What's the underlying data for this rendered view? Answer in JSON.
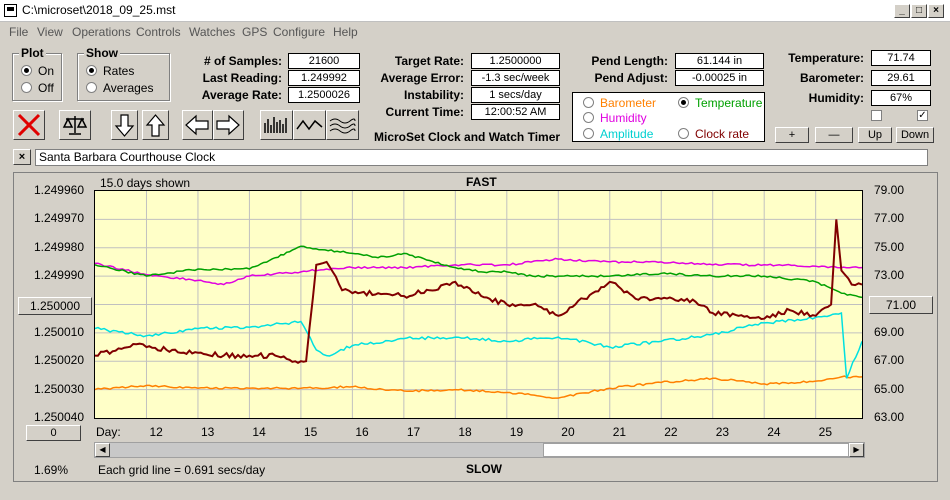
{
  "window": {
    "title": "C:\\microset\\2018_09_25.mst",
    "min": "_",
    "max": "□",
    "close": "×"
  },
  "menu": [
    "File",
    "View",
    "Operations",
    "Controls",
    "Watches",
    "GPS",
    "Configure",
    "Help"
  ],
  "plot_group": {
    "title": "Plot",
    "on": "On",
    "off": "Off"
  },
  "show_group": {
    "title": "Show",
    "rates": "Rates",
    "averages": "Averages"
  },
  "stats": {
    "samples_label": "# of Samples:",
    "samples": "21600",
    "last_label": "Last Reading:",
    "last": "1.249992",
    "avg_label": "Average Rate:",
    "avg": "1.2500026"
  },
  "rates": {
    "target_label": "Target Rate:",
    "target": "1.2500000",
    "avgerr_label": "Average Error:",
    "avgerr": "-1.3 sec/week",
    "instab_label": "Instability:",
    "instab": "1 secs/day",
    "time_label": "Current Time:",
    "time": "12:00:52 AM"
  },
  "pend": {
    "length_label": "Pend Length:",
    "length": "61.144 in",
    "adjust_label": "Pend Adjust:",
    "adjust": "-0.00025 in"
  },
  "sensor_options": {
    "barometer": "Barometer",
    "temperature": "Temperature",
    "humidity": "Humidity",
    "amplitude": "Amplitude",
    "clock_rate": "Clock rate"
  },
  "colors": {
    "barometer": "#ff8000",
    "temperature": "#00a000",
    "humidity": "#e000e0",
    "amplitude": "#00e0e0",
    "rate": "#800000"
  },
  "env": {
    "temp_label": "Temperature:",
    "temp": "71.74",
    "baro_label": "Barometer:",
    "baro": "29.61",
    "hum_label": "Humidity:",
    "hum": "67%"
  },
  "adjust_buttons": {
    "plus": "+",
    "minus": "—",
    "up": "Up",
    "down": "Down"
  },
  "app_title": "MicroSet Clock and Watch Timer",
  "clock_name": "Santa Barbara Courthouse Clock",
  "chart_data": {
    "type": "line",
    "title": "FAST",
    "bottom_label": "SLOW",
    "days_shown": "15.0 days shown",
    "grid_note": "Each grid line = 0.691 secs/day",
    "percent": "1.69%",
    "left_center_button": "1.250000",
    "right_center_button": "71.00",
    "zero_button": "0",
    "x_label": "Day:",
    "x_ticks": [
      "12",
      "13",
      "14",
      "15",
      "16",
      "17",
      "18",
      "19",
      "20",
      "21",
      "22",
      "23",
      "24",
      "25"
    ],
    "y_left_ticks": [
      "1.249960",
      "1.249970",
      "1.249980",
      "1.249990",
      "1.250000",
      "1.250010",
      "1.250020",
      "1.250030",
      "1.250040"
    ],
    "y_right_ticks": [
      "79.00",
      "77.00",
      "75.00",
      "73.00",
      "71.00",
      "69.00",
      "67.00",
      "65.00",
      "63.00"
    ],
    "x_range": [
      11,
      25.9
    ],
    "y_left_range": [
      1.24996,
      1.25004
    ],
    "y_right_range": [
      63,
      79
    ],
    "series": [
      {
        "key": "rate",
        "axis": "left",
        "x": [
          11,
          11.8,
          12,
          12.5,
          13,
          13.5,
          14,
          14.5,
          15,
          15.1,
          15.3,
          15.5,
          15.8,
          16,
          16.5,
          17,
          17.5,
          18,
          18.5,
          19,
          19.5,
          20,
          20.5,
          21,
          21.5,
          22,
          22.5,
          23,
          23.5,
          24,
          24.5,
          25,
          25.3,
          25.4,
          25.5,
          25.7,
          25.9
        ],
        "y": [
          1.250018,
          1.250014,
          1.250015,
          1.250016,
          1.250017,
          1.250018,
          1.250018,
          1.250018,
          1.25002,
          1.25002,
          1.249986,
          1.249985,
          1.249995,
          1.249996,
          1.249996,
          1.249997,
          1.249995,
          1.249992,
          1.249997,
          1.25,
          1.25,
          1.250004,
          1.249998,
          1.249992,
          1.249998,
          1.249998,
          1.249998,
          1.250003,
          1.250004,
          1.250005,
          1.250002,
          1.250004,
          1.25,
          1.24997,
          1.249988,
          1.249993,
          1.249993
        ]
      },
      {
        "key": "temperature",
        "axis": "right",
        "x": [
          11,
          12,
          13,
          14,
          14.5,
          15,
          16,
          16.5,
          17,
          17.5,
          18,
          18.5,
          19,
          19.5,
          20,
          21,
          22,
          23,
          24,
          25,
          25.5,
          25.9
        ],
        "y": [
          73.8,
          73.0,
          73.5,
          73.5,
          74.3,
          75.1,
          74.6,
          74.3,
          74.6,
          74.1,
          73.6,
          73.3,
          73.3,
          73.0,
          73.0,
          73.0,
          73.2,
          73.0,
          73.0,
          72.6,
          71.8,
          71.5
        ]
      },
      {
        "key": "humidity",
        "axis": "right",
        "x": [
          11,
          12,
          13,
          13.5,
          14,
          15,
          15.5,
          16,
          17,
          18,
          19,
          20,
          21,
          22,
          23,
          24,
          25,
          25.9
        ],
        "y": [
          73.9,
          73.1,
          72.7,
          72.4,
          73.0,
          73.3,
          73.5,
          73.6,
          73.6,
          73.8,
          73.8,
          74.2,
          74.0,
          74.0,
          73.8,
          73.8,
          73.7,
          73.6
        ]
      },
      {
        "key": "amplitude",
        "axis": "right",
        "x": [
          11,
          12,
          13,
          14,
          15,
          15.3,
          15.5,
          16,
          17,
          18,
          19,
          20,
          21,
          22,
          23,
          24,
          25,
          25.5,
          25.6,
          25.9
        ],
        "y": [
          69.3,
          68.8,
          69.3,
          69.4,
          69.8,
          67.8,
          67.4,
          68.1,
          68.6,
          68.7,
          68.4,
          68.7,
          68.0,
          68.4,
          68.9,
          69.7,
          70.1,
          70.4,
          65.8,
          68.4
        ]
      },
      {
        "key": "barometer",
        "axis": "right",
        "x": [
          11,
          12,
          13,
          14,
          15,
          16,
          17,
          18,
          19,
          20,
          21,
          22,
          23,
          24,
          25,
          25.5,
          25.9
        ],
        "y": [
          65.0,
          65.3,
          65.1,
          65.1,
          65.1,
          65.2,
          64.9,
          65.0,
          64.8,
          64.4,
          65.1,
          65.5,
          65.8,
          65.4,
          65.6,
          65.9,
          65.9
        ]
      }
    ]
  }
}
